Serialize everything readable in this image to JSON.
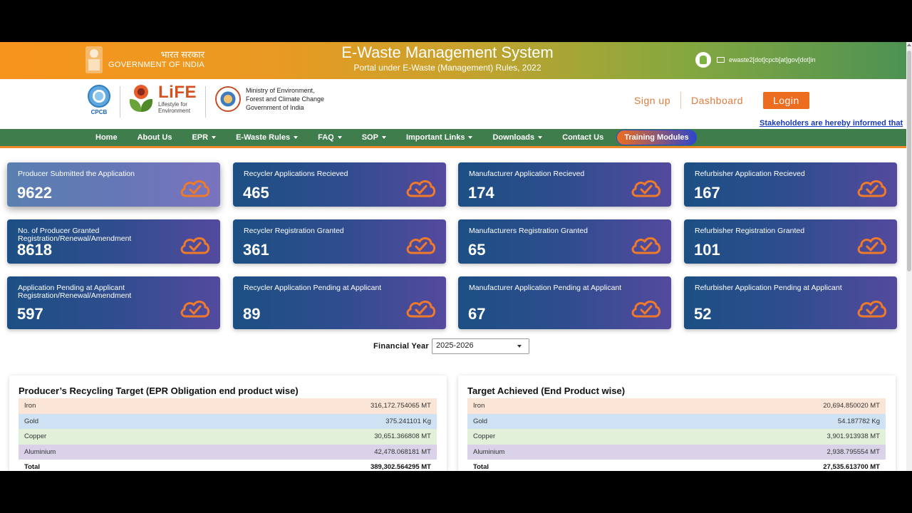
{
  "header": {
    "gov_hindi": "भारत सरकार",
    "gov_english": "GOVERNMENT OF INDIA",
    "site_title": "E-Waste Management System",
    "site_subtitle": "Portal under E-Waste (Management) Rules, 2022",
    "contact_email": "ewaste2[dot]cpcb[at]gov[dot]in"
  },
  "logos": {
    "cpcb": "CPCB",
    "life_title": "LiFE",
    "life_tagline_1": "Lifestyle for",
    "life_tagline_2": "Environment",
    "ministry_line_1": "Ministry of Environment,",
    "ministry_line_2": "Forest and Climate Change",
    "ministry_line_3": "Government of India"
  },
  "auth": {
    "signup": "Sign up",
    "dashboard": "Dashboard",
    "login": "Login"
  },
  "marquee": "Stakeholders are hereby informed that",
  "nav": {
    "home": "Home",
    "about": "About Us",
    "epr": "EPR",
    "rules": "E-Waste Rules",
    "faq": "FAQ",
    "sop": "SOP",
    "links": "Important Links",
    "downloads": "Downloads",
    "contact": "Contact Us",
    "training": "Training Modules"
  },
  "cards": [
    {
      "label": "Producer Submitted the Application",
      "value": "9622"
    },
    {
      "label": "Recycler Applications Recieved",
      "value": "465"
    },
    {
      "label": "Manufacturer Application Recieved",
      "value": "174"
    },
    {
      "label": "Refurbisher Application Recieved",
      "value": "167"
    },
    {
      "label": "No. of Producer Granted Registration/Renewal/Amendment",
      "value": "8618"
    },
    {
      "label": "Recycler Registration Granted",
      "value": "361"
    },
    {
      "label": "Manufacturers Registration Granted",
      "value": "65"
    },
    {
      "label": "Refurbisher Registration Granted",
      "value": "101"
    },
    {
      "label": "Application Pending at Applicant Registration/Renewal/Amendment",
      "value": "597"
    },
    {
      "label": "Recycler Application Pending at Applicant",
      "value": "89"
    },
    {
      "label": "Manufacturer Application Pending at Applicant",
      "value": "67"
    },
    {
      "label": "Refurbisher Application Pending at Applicant",
      "value": "52"
    }
  ],
  "financial_year": {
    "label": "Financial Year",
    "selected": "2025-2026"
  },
  "target_panel": {
    "title": "Producer’s Recycling Target (EPR Obligation end product wise)",
    "rows": [
      {
        "name": "Iron",
        "value": "316,172.754065 MT"
      },
      {
        "name": "Gold",
        "value": "375.241101 Kg"
      },
      {
        "name": "Copper",
        "value": "30,651.366808 MT"
      },
      {
        "name": "Aluminium",
        "value": "42,478.068181 MT"
      },
      {
        "name": "Total",
        "value": "389,302.564295 MT"
      }
    ]
  },
  "achieved_panel": {
    "title": "Target Achieved (End Product wise)",
    "rows": [
      {
        "name": "Iron",
        "value": "20,694.850020 MT"
      },
      {
        "name": "Gold",
        "value": "54.187782 Kg"
      },
      {
        "name": "Copper",
        "value": "3,901.913938 MT"
      },
      {
        "name": "Aluminium",
        "value": "2,938.795554 MT"
      },
      {
        "name": "Total",
        "value": "27,535.613700 MT"
      }
    ]
  },
  "colors": {
    "accent_orange": "#ec6c20",
    "nav_green": "#3f7d4d",
    "card_blue": "#1c4f84",
    "card_purple": "#544a9e"
  }
}
